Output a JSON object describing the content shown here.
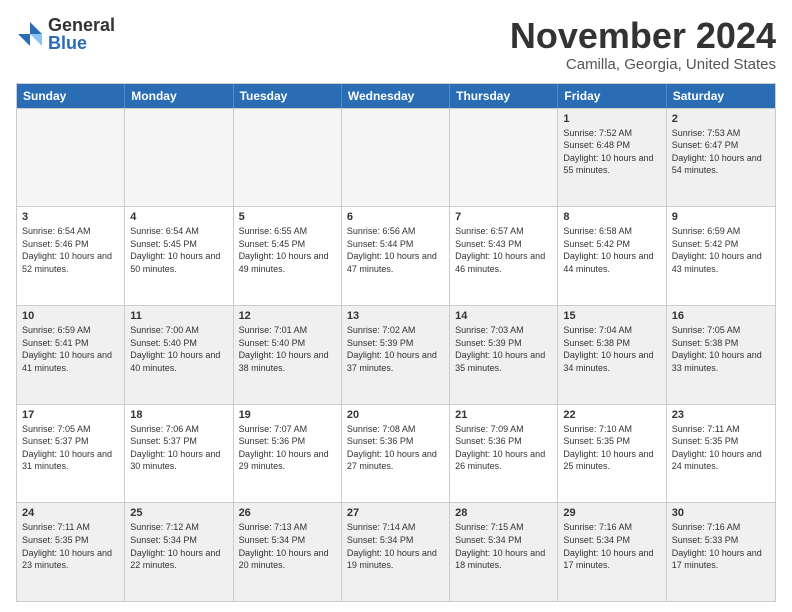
{
  "logo": {
    "general": "General",
    "blue": "Blue"
  },
  "title": "November 2024",
  "subtitle": "Camilla, Georgia, United States",
  "days_of_week": [
    "Sunday",
    "Monday",
    "Tuesday",
    "Wednesday",
    "Thursday",
    "Friday",
    "Saturday"
  ],
  "weeks": [
    [
      {
        "day": "",
        "empty": true
      },
      {
        "day": "",
        "empty": true
      },
      {
        "day": "",
        "empty": true
      },
      {
        "day": "",
        "empty": true
      },
      {
        "day": "",
        "empty": true
      },
      {
        "day": "1",
        "sunrise": "7:52 AM",
        "sunset": "6:48 PM",
        "daylight": "10 hours and 55 minutes."
      },
      {
        "day": "2",
        "sunrise": "7:53 AM",
        "sunset": "6:47 PM",
        "daylight": "10 hours and 54 minutes."
      }
    ],
    [
      {
        "day": "3",
        "sunrise": "6:54 AM",
        "sunset": "5:46 PM",
        "daylight": "10 hours and 52 minutes."
      },
      {
        "day": "4",
        "sunrise": "6:54 AM",
        "sunset": "5:45 PM",
        "daylight": "10 hours and 50 minutes."
      },
      {
        "day": "5",
        "sunrise": "6:55 AM",
        "sunset": "5:45 PM",
        "daylight": "10 hours and 49 minutes."
      },
      {
        "day": "6",
        "sunrise": "6:56 AM",
        "sunset": "5:44 PM",
        "daylight": "10 hours and 47 minutes."
      },
      {
        "day": "7",
        "sunrise": "6:57 AM",
        "sunset": "5:43 PM",
        "daylight": "10 hours and 46 minutes."
      },
      {
        "day": "8",
        "sunrise": "6:58 AM",
        "sunset": "5:42 PM",
        "daylight": "10 hours and 44 minutes."
      },
      {
        "day": "9",
        "sunrise": "6:59 AM",
        "sunset": "5:42 PM",
        "daylight": "10 hours and 43 minutes."
      }
    ],
    [
      {
        "day": "10",
        "sunrise": "6:59 AM",
        "sunset": "5:41 PM",
        "daylight": "10 hours and 41 minutes."
      },
      {
        "day": "11",
        "sunrise": "7:00 AM",
        "sunset": "5:40 PM",
        "daylight": "10 hours and 40 minutes."
      },
      {
        "day": "12",
        "sunrise": "7:01 AM",
        "sunset": "5:40 PM",
        "daylight": "10 hours and 38 minutes."
      },
      {
        "day": "13",
        "sunrise": "7:02 AM",
        "sunset": "5:39 PM",
        "daylight": "10 hours and 37 minutes."
      },
      {
        "day": "14",
        "sunrise": "7:03 AM",
        "sunset": "5:39 PM",
        "daylight": "10 hours and 35 minutes."
      },
      {
        "day": "15",
        "sunrise": "7:04 AM",
        "sunset": "5:38 PM",
        "daylight": "10 hours and 34 minutes."
      },
      {
        "day": "16",
        "sunrise": "7:05 AM",
        "sunset": "5:38 PM",
        "daylight": "10 hours and 33 minutes."
      }
    ],
    [
      {
        "day": "17",
        "sunrise": "7:05 AM",
        "sunset": "5:37 PM",
        "daylight": "10 hours and 31 minutes."
      },
      {
        "day": "18",
        "sunrise": "7:06 AM",
        "sunset": "5:37 PM",
        "daylight": "10 hours and 30 minutes."
      },
      {
        "day": "19",
        "sunrise": "7:07 AM",
        "sunset": "5:36 PM",
        "daylight": "10 hours and 29 minutes."
      },
      {
        "day": "20",
        "sunrise": "7:08 AM",
        "sunset": "5:36 PM",
        "daylight": "10 hours and 27 minutes."
      },
      {
        "day": "21",
        "sunrise": "7:09 AM",
        "sunset": "5:36 PM",
        "daylight": "10 hours and 26 minutes."
      },
      {
        "day": "22",
        "sunrise": "7:10 AM",
        "sunset": "5:35 PM",
        "daylight": "10 hours and 25 minutes."
      },
      {
        "day": "23",
        "sunrise": "7:11 AM",
        "sunset": "5:35 PM",
        "daylight": "10 hours and 24 minutes."
      }
    ],
    [
      {
        "day": "24",
        "sunrise": "7:11 AM",
        "sunset": "5:35 PM",
        "daylight": "10 hours and 23 minutes."
      },
      {
        "day": "25",
        "sunrise": "7:12 AM",
        "sunset": "5:34 PM",
        "daylight": "10 hours and 22 minutes."
      },
      {
        "day": "26",
        "sunrise": "7:13 AM",
        "sunset": "5:34 PM",
        "daylight": "10 hours and 20 minutes."
      },
      {
        "day": "27",
        "sunrise": "7:14 AM",
        "sunset": "5:34 PM",
        "daylight": "10 hours and 19 minutes."
      },
      {
        "day": "28",
        "sunrise": "7:15 AM",
        "sunset": "5:34 PM",
        "daylight": "10 hours and 18 minutes."
      },
      {
        "day": "29",
        "sunrise": "7:16 AM",
        "sunset": "5:34 PM",
        "daylight": "10 hours and 17 minutes."
      },
      {
        "day": "30",
        "sunrise": "7:16 AM",
        "sunset": "5:33 PM",
        "daylight": "10 hours and 17 minutes."
      }
    ]
  ]
}
